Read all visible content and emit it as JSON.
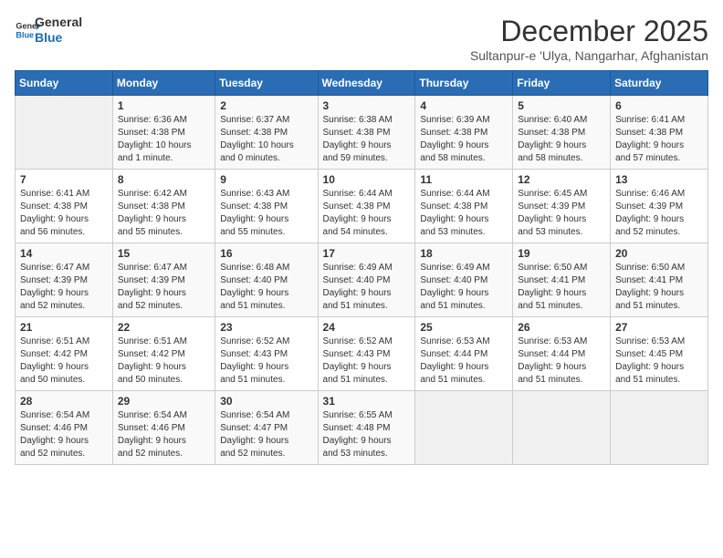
{
  "logo": {
    "line1": "General",
    "line2": "Blue"
  },
  "title": "December 2025",
  "subtitle": "Sultanpur-e 'Ulya, Nangarhar, Afghanistan",
  "weekdays": [
    "Sunday",
    "Monday",
    "Tuesday",
    "Wednesday",
    "Thursday",
    "Friday",
    "Saturday"
  ],
  "weeks": [
    [
      {
        "day": "",
        "info": ""
      },
      {
        "day": "1",
        "info": "Sunrise: 6:36 AM\nSunset: 4:38 PM\nDaylight: 10 hours\nand 1 minute."
      },
      {
        "day": "2",
        "info": "Sunrise: 6:37 AM\nSunset: 4:38 PM\nDaylight: 10 hours\nand 0 minutes."
      },
      {
        "day": "3",
        "info": "Sunrise: 6:38 AM\nSunset: 4:38 PM\nDaylight: 9 hours\nand 59 minutes."
      },
      {
        "day": "4",
        "info": "Sunrise: 6:39 AM\nSunset: 4:38 PM\nDaylight: 9 hours\nand 58 minutes."
      },
      {
        "day": "5",
        "info": "Sunrise: 6:40 AM\nSunset: 4:38 PM\nDaylight: 9 hours\nand 58 minutes."
      },
      {
        "day": "6",
        "info": "Sunrise: 6:41 AM\nSunset: 4:38 PM\nDaylight: 9 hours\nand 57 minutes."
      }
    ],
    [
      {
        "day": "7",
        "info": "Sunrise: 6:41 AM\nSunset: 4:38 PM\nDaylight: 9 hours\nand 56 minutes."
      },
      {
        "day": "8",
        "info": "Sunrise: 6:42 AM\nSunset: 4:38 PM\nDaylight: 9 hours\nand 55 minutes."
      },
      {
        "day": "9",
        "info": "Sunrise: 6:43 AM\nSunset: 4:38 PM\nDaylight: 9 hours\nand 55 minutes."
      },
      {
        "day": "10",
        "info": "Sunrise: 6:44 AM\nSunset: 4:38 PM\nDaylight: 9 hours\nand 54 minutes."
      },
      {
        "day": "11",
        "info": "Sunrise: 6:44 AM\nSunset: 4:38 PM\nDaylight: 9 hours\nand 53 minutes."
      },
      {
        "day": "12",
        "info": "Sunrise: 6:45 AM\nSunset: 4:39 PM\nDaylight: 9 hours\nand 53 minutes."
      },
      {
        "day": "13",
        "info": "Sunrise: 6:46 AM\nSunset: 4:39 PM\nDaylight: 9 hours\nand 52 minutes."
      }
    ],
    [
      {
        "day": "14",
        "info": "Sunrise: 6:47 AM\nSunset: 4:39 PM\nDaylight: 9 hours\nand 52 minutes."
      },
      {
        "day": "15",
        "info": "Sunrise: 6:47 AM\nSunset: 4:39 PM\nDaylight: 9 hours\nand 52 minutes."
      },
      {
        "day": "16",
        "info": "Sunrise: 6:48 AM\nSunset: 4:40 PM\nDaylight: 9 hours\nand 51 minutes."
      },
      {
        "day": "17",
        "info": "Sunrise: 6:49 AM\nSunset: 4:40 PM\nDaylight: 9 hours\nand 51 minutes."
      },
      {
        "day": "18",
        "info": "Sunrise: 6:49 AM\nSunset: 4:40 PM\nDaylight: 9 hours\nand 51 minutes."
      },
      {
        "day": "19",
        "info": "Sunrise: 6:50 AM\nSunset: 4:41 PM\nDaylight: 9 hours\nand 51 minutes."
      },
      {
        "day": "20",
        "info": "Sunrise: 6:50 AM\nSunset: 4:41 PM\nDaylight: 9 hours\nand 51 minutes."
      }
    ],
    [
      {
        "day": "21",
        "info": "Sunrise: 6:51 AM\nSunset: 4:42 PM\nDaylight: 9 hours\nand 50 minutes."
      },
      {
        "day": "22",
        "info": "Sunrise: 6:51 AM\nSunset: 4:42 PM\nDaylight: 9 hours\nand 50 minutes."
      },
      {
        "day": "23",
        "info": "Sunrise: 6:52 AM\nSunset: 4:43 PM\nDaylight: 9 hours\nand 51 minutes."
      },
      {
        "day": "24",
        "info": "Sunrise: 6:52 AM\nSunset: 4:43 PM\nDaylight: 9 hours\nand 51 minutes."
      },
      {
        "day": "25",
        "info": "Sunrise: 6:53 AM\nSunset: 4:44 PM\nDaylight: 9 hours\nand 51 minutes."
      },
      {
        "day": "26",
        "info": "Sunrise: 6:53 AM\nSunset: 4:44 PM\nDaylight: 9 hours\nand 51 minutes."
      },
      {
        "day": "27",
        "info": "Sunrise: 6:53 AM\nSunset: 4:45 PM\nDaylight: 9 hours\nand 51 minutes."
      }
    ],
    [
      {
        "day": "28",
        "info": "Sunrise: 6:54 AM\nSunset: 4:46 PM\nDaylight: 9 hours\nand 52 minutes."
      },
      {
        "day": "29",
        "info": "Sunrise: 6:54 AM\nSunset: 4:46 PM\nDaylight: 9 hours\nand 52 minutes."
      },
      {
        "day": "30",
        "info": "Sunrise: 6:54 AM\nSunset: 4:47 PM\nDaylight: 9 hours\nand 52 minutes."
      },
      {
        "day": "31",
        "info": "Sunrise: 6:55 AM\nSunset: 4:48 PM\nDaylight: 9 hours\nand 53 minutes."
      },
      {
        "day": "",
        "info": ""
      },
      {
        "day": "",
        "info": ""
      },
      {
        "day": "",
        "info": ""
      }
    ]
  ]
}
